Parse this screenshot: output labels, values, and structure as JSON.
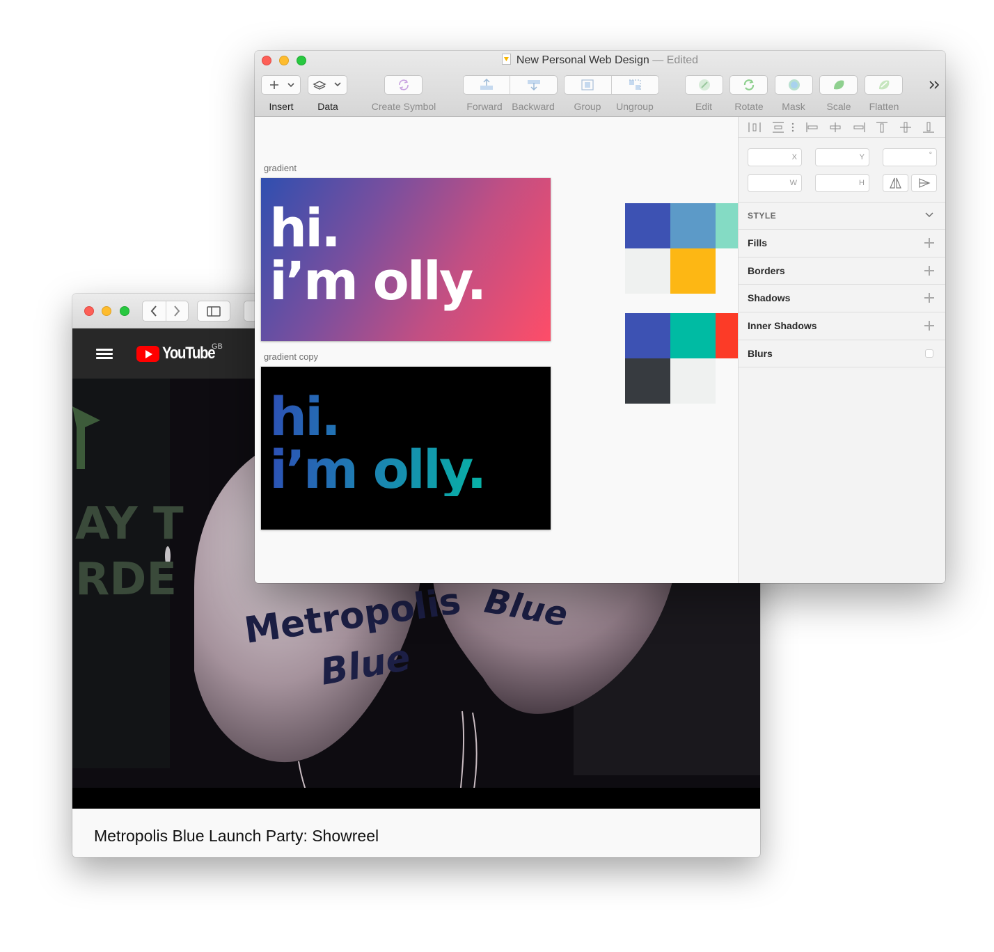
{
  "browser": {
    "region_badge": "GB",
    "logo_text": "YouTube",
    "video": {
      "balloon_left_text_1": "Metropolis",
      "balloon_left_text_2": "Blue",
      "balloon_right_text": "Blue",
      "wall_text_1": "AY T",
      "wall_text_2": "RDE",
      "caption": "Metropolis Blue Launch Party: Showreel"
    }
  },
  "sketch": {
    "title": "New Personal Web Design",
    "title_suffix": " — Edited",
    "toolbar": {
      "insert": "Insert",
      "data": "Data",
      "create_symbol": "Create Symbol",
      "forward": "Forward",
      "backward": "Backward",
      "group": "Group",
      "ungroup": "Ungroup",
      "edit": "Edit",
      "rotate": "Rotate",
      "mask": "Mask",
      "scale": "Scale",
      "flatten": "Flatten"
    },
    "artboards": [
      {
        "label": "gradient",
        "line1": "hi.",
        "line2": "i’m olly."
      },
      {
        "label": "gradient copy",
        "line1": "hi.",
        "line2": "i’m olly."
      }
    ],
    "palette_colors": {
      "group1": [
        "#3d52b3",
        "#5c9ac8",
        "#84dbc4",
        "#eff1f0",
        "#fdb714"
      ],
      "group2": [
        "#3d52b3",
        "#00bba3",
        "#fc3b27",
        "#373b40",
        "#eff1f0"
      ]
    },
    "inspector": {
      "fields": {
        "x": "X",
        "y": "Y",
        "rotation": "°",
        "w": "W",
        "h": "H"
      },
      "style_header": "STYLE",
      "rows": [
        "Fills",
        "Borders",
        "Shadows",
        "Inner Shadows",
        "Blurs"
      ]
    }
  }
}
